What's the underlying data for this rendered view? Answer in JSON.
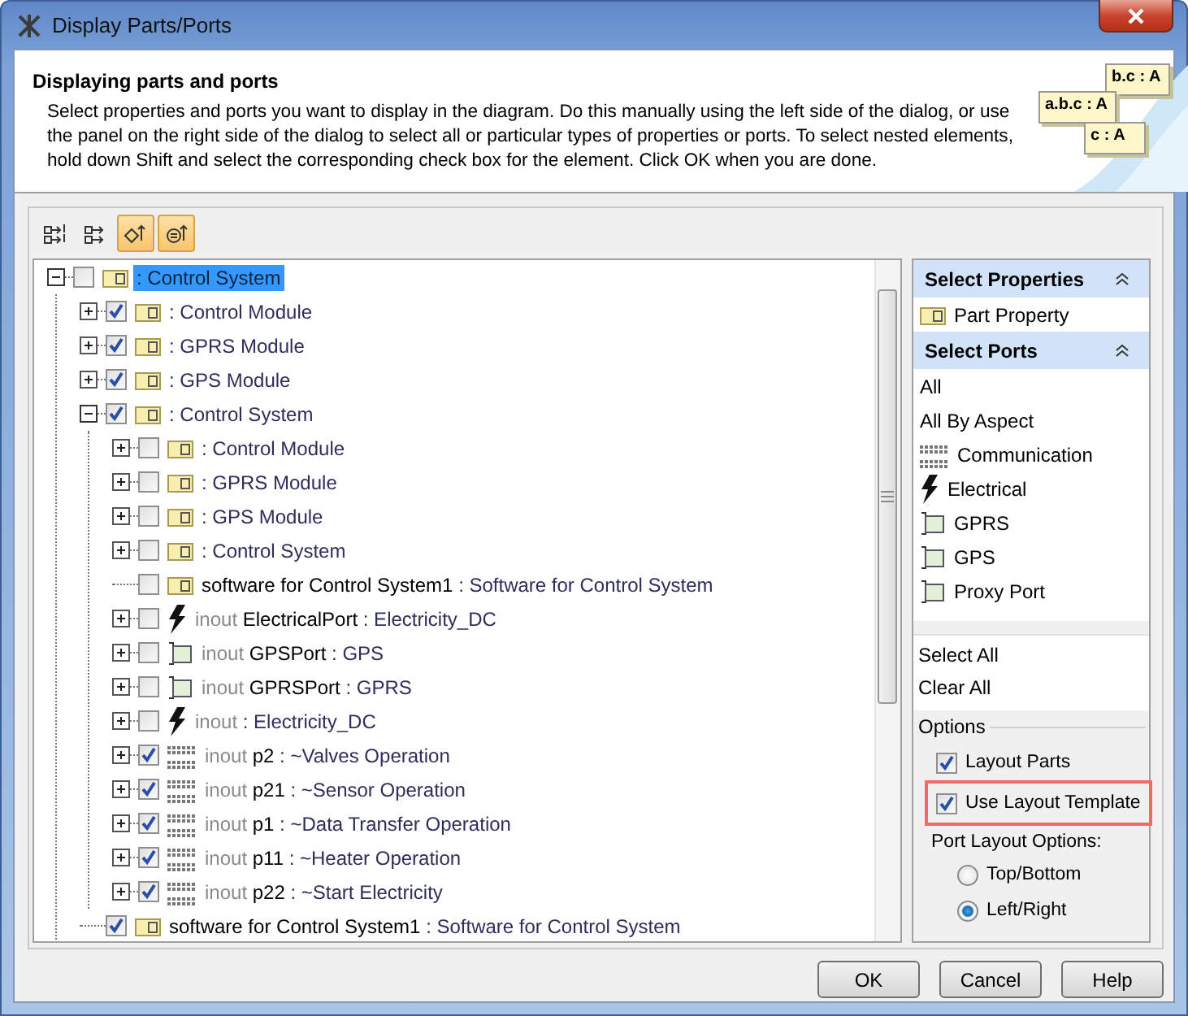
{
  "window": {
    "title": "Display Parts/Ports"
  },
  "header": {
    "heading": "Displaying parts and ports",
    "description": "Select properties and ports you want to display in the diagram. Do this manually using the left side of the dialog, or use the panel on the right side of the dialog to select all or particular types of properties or ports. To select nested elements, hold down Shift and select the corresponding check box for the element. Click OK when you are done.",
    "notes": [
      "b.c : A",
      "a.b.c : A",
      "c : A"
    ]
  },
  "toolbar": [
    {
      "kind": "expand",
      "pressed": false
    },
    {
      "kind": "collapse",
      "pressed": false
    },
    {
      "kind": "ports",
      "pressed": true
    },
    {
      "kind": "parts",
      "pressed": true
    }
  ],
  "tree": [
    {
      "expandable": true,
      "expanded": true,
      "checked": false,
      "kind": "part",
      "type": ": Control System",
      "selected": true,
      "children": [
        {
          "expandable": true,
          "expanded": false,
          "checked": true,
          "kind": "part",
          "type": ": Control Module",
          "selected": false
        },
        {
          "expandable": true,
          "expanded": false,
          "checked": true,
          "kind": "part",
          "type": ": GPRS Module",
          "selected": false
        },
        {
          "expandable": true,
          "expanded": false,
          "checked": true,
          "kind": "part",
          "type": ": GPS Module",
          "selected": false
        },
        {
          "expandable": true,
          "expanded": true,
          "checked": true,
          "kind": "part",
          "type": ": Control System",
          "selected": false,
          "children": [
            {
              "expandable": true,
              "expanded": false,
              "checked": false,
              "kind": "part",
              "type": ": Control Module",
              "selected": false
            },
            {
              "expandable": true,
              "expanded": false,
              "checked": false,
              "kind": "part",
              "type": ": GPRS Module",
              "selected": false
            },
            {
              "expandable": true,
              "expanded": false,
              "checked": false,
              "kind": "part",
              "type": ": GPS Module",
              "selected": false
            },
            {
              "expandable": true,
              "expanded": false,
              "checked": false,
              "kind": "part",
              "type": ": Control System",
              "selected": false
            },
            {
              "expandable": false,
              "checked": false,
              "kind": "part",
              "name": "software for Control System1",
              "type": ": Software for Control System",
              "selected": false
            },
            {
              "expandable": true,
              "expanded": false,
              "checked": false,
              "kind": "electrical",
              "direction": "inout",
              "name": "ElectricalPort",
              "type": ": Electricity_DC",
              "selected": false
            },
            {
              "expandable": true,
              "expanded": false,
              "checked": false,
              "kind": "proxy",
              "direction": "inout",
              "name": "GPSPort",
              "type": ": GPS",
              "selected": false
            },
            {
              "expandable": true,
              "expanded": false,
              "checked": false,
              "kind": "proxy",
              "direction": "inout",
              "name": "GPRSPort",
              "type": ": GPRS",
              "selected": false
            },
            {
              "expandable": true,
              "expanded": false,
              "checked": false,
              "kind": "electrical",
              "direction": "inout",
              "type": ": Electricity_DC",
              "selected": false
            },
            {
              "expandable": true,
              "expanded": false,
              "checked": true,
              "kind": "communication",
              "direction": "inout",
              "name": "p2",
              "type": ": ~Valves Operation",
              "selected": false
            },
            {
              "expandable": true,
              "expanded": false,
              "checked": true,
              "kind": "communication",
              "direction": "inout",
              "name": "p21",
              "type": ": ~Sensor Operation",
              "selected": false
            },
            {
              "expandable": true,
              "expanded": false,
              "checked": true,
              "kind": "communication",
              "direction": "inout",
              "name": "p1",
              "type": ": ~Data Transfer Operation",
              "selected": false
            },
            {
              "expandable": true,
              "expanded": false,
              "checked": true,
              "kind": "communication",
              "direction": "inout",
              "name": "p11",
              "type": ": ~Heater Operation",
              "selected": false
            },
            {
              "expandable": true,
              "expanded": false,
              "checked": true,
              "kind": "communication",
              "direction": "inout",
              "name": "p22",
              "type": ": ~Start Electricity",
              "selected": false
            }
          ]
        },
        {
          "expandable": false,
          "checked": true,
          "kind": "part",
          "name": "software for Control System1",
          "type": ": Software for Control System",
          "selected": false
        }
      ]
    }
  ],
  "right_panel": {
    "sections": [
      {
        "title": "Select Properties",
        "expanded": true,
        "items": [
          {
            "kind": "part",
            "label": "Part Property"
          }
        ]
      },
      {
        "title": "Select Ports",
        "expanded": true,
        "items": [
          {
            "kind": "text",
            "label": "All"
          },
          {
            "kind": "text",
            "label": "All By Aspect"
          },
          {
            "kind": "communication",
            "label": "Communication"
          },
          {
            "kind": "electrical",
            "label": "Electrical"
          },
          {
            "kind": "proxy",
            "label": "GPRS"
          },
          {
            "kind": "proxy",
            "label": "GPS"
          },
          {
            "kind": "proxy",
            "label": "Proxy Port"
          }
        ]
      }
    ],
    "actions": [
      "Select All",
      "Clear All"
    ],
    "options": {
      "title": "Options",
      "checkboxes": [
        {
          "label": "Layout Parts",
          "checked": true,
          "highlighted": false
        },
        {
          "label": "Use Layout Template",
          "checked": true,
          "highlighted": true
        }
      ],
      "port_layout_label": "Port Layout Options:",
      "radios": [
        {
          "label": "Top/Bottom",
          "selected": false
        },
        {
          "label": "Left/Right",
          "selected": true
        }
      ]
    }
  },
  "buttons": [
    "OK",
    "Cancel",
    "Help"
  ]
}
